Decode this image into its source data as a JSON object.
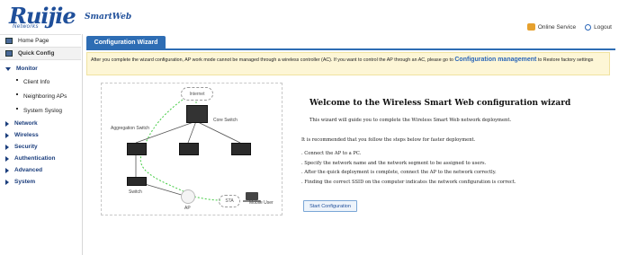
{
  "header": {
    "logo_text": "Ruijie",
    "logo_sub": "Networks",
    "product_name": "SmartWeb",
    "online_service": "Online Service",
    "logout": "Logout"
  },
  "sidebar": {
    "home": "Home Page",
    "quick_config": "Quick Config",
    "monitor": "Monitor",
    "monitor_items": [
      "Client Info",
      "Neighboring APs",
      "System Syslog"
    ],
    "sections": [
      "Network",
      "Wireless",
      "Security",
      "Authentication",
      "Advanced",
      "System"
    ]
  },
  "tab": {
    "label": "Configuration Wizard"
  },
  "notice": {
    "text_before": "After you complete the wizard configuration, AP work mode cannot be managed through a wireless controller (AC). If you want to control the AP through an AC, please go to ",
    "link": "Configuration management",
    "text_after": " to Restore factory settings"
  },
  "diagram": {
    "internet": "Internet",
    "core_switch": "Core Switch",
    "aggregation_switch": "Aggregation Switch",
    "switch": "Switch",
    "ap": "AP",
    "sta": "STA",
    "mobile_user": "Mobile User"
  },
  "welcome": {
    "title": "Welcome to the Wireless Smart Web configuration wizard",
    "desc": "This wizard will guide you to complete the Wireless Smart Web network deployment.",
    "recommend": "It is recommended that you follow the steps below for faster deployment.",
    "steps": [
      ". Connect the AP to a PC.",
      ". Specify the network name and the network segment to be assigned to users.",
      ". After the quick deployment is complete, connect the AP to the network correctly.",
      ". Finding the correct SSID on the computer indicates the network configuration is correct."
    ],
    "start_button": "Start Configuration"
  }
}
